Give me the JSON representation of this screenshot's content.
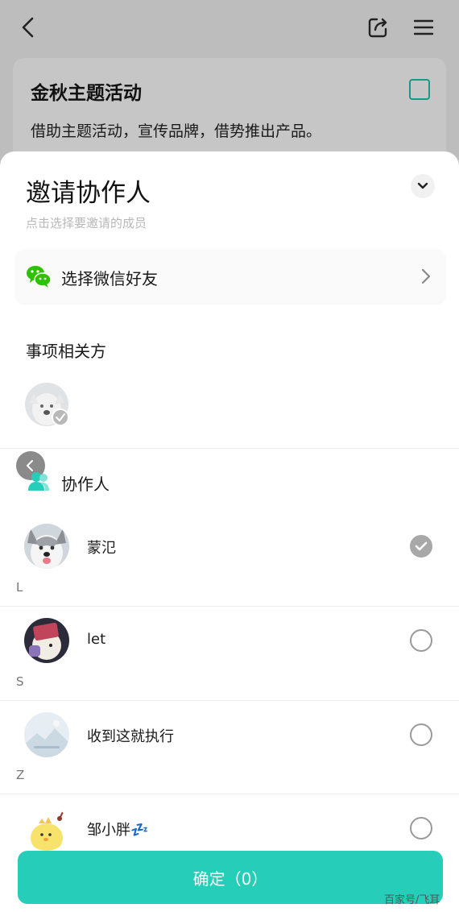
{
  "background_page": {
    "card_title": "金秋主题活动",
    "card_description": "借助主题活动，宣传品牌，借势推出产品。"
  },
  "sheet": {
    "title": "邀请协作人",
    "subtitle": "点击选择要邀请的成员",
    "wechat_label": "选择微信好友",
    "stakeholders_title": "事项相关方",
    "collaborators_label": "协作人",
    "members": [
      {
        "index_letter": "",
        "name": "蒙氾",
        "selected": true,
        "avatar": "husky-dog-avatar"
      },
      {
        "index_letter": "L",
        "name": "let",
        "selected": false,
        "avatar": "dark-cartoon-avatar"
      },
      {
        "index_letter": "S",
        "name": "收到这就执行",
        "selected": false,
        "avatar": "landscape-avatar"
      },
      {
        "index_letter": "Z",
        "name": "邹小胖💤",
        "selected": false,
        "avatar": "yellow-chick-avatar"
      }
    ],
    "confirm_label": "确定（0）"
  },
  "watermark": "百家号/飞耳",
  "colors": {
    "accent": "#26cdb8",
    "checkbox_border": "#159a86",
    "wechat_green": "#2dc100"
  }
}
